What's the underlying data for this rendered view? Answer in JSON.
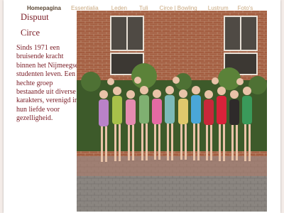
{
  "nav": {
    "items": [
      "Homepagina",
      "Essentialia",
      "Leden",
      "Tuli",
      "Circe | Bowling",
      "Lustrum",
      "Foto's"
    ],
    "active_index": 0
  },
  "title": {
    "line1": "Dispuut",
    "line2": "Circe"
  },
  "description": "Sinds 1971 een bruisende kracht binnen het Nijmeegse studenten leven. Een hechte groep bestaande uit diverse karakters, verenigd in hun liefde voor gezelligheid.",
  "colors": {
    "accent": "#7a1c25",
    "nav_link": "#c9a77d",
    "nav_active": "#5a4633",
    "brick": "#9c5a3f"
  }
}
